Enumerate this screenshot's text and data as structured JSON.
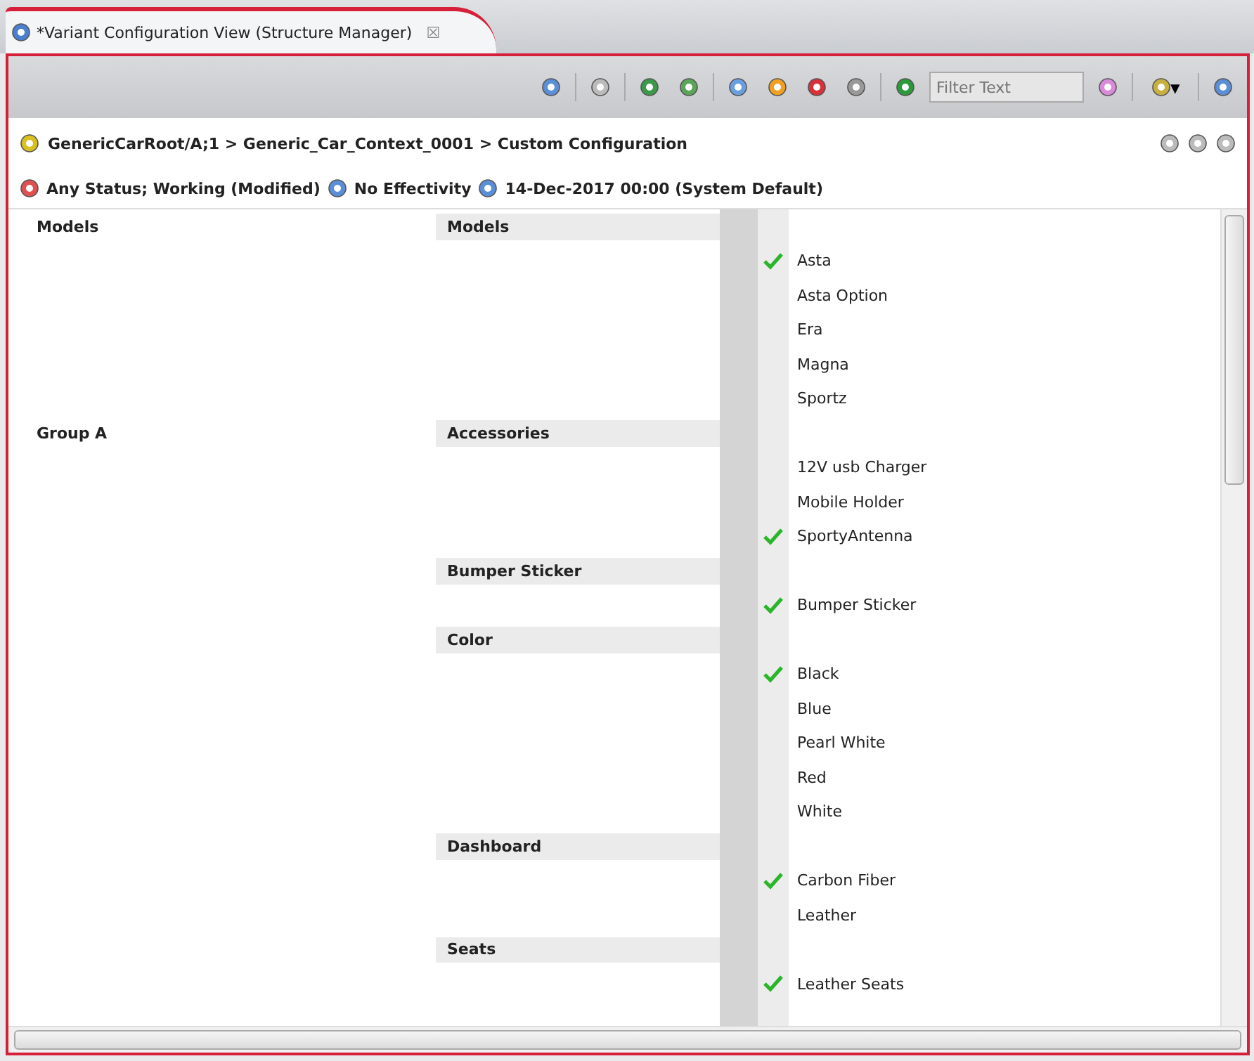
{
  "tab": {
    "title": "*Variant Configuration View (Structure Manager)",
    "close": "☒"
  },
  "toolbar": {
    "filter": {
      "placeholder": "Filter Text"
    },
    "dropdown": "▾"
  },
  "breadcrumb": "GenericCarRoot/A;1 > Generic_Car_Context_0001 > Custom Configuration",
  "status": [
    "Any Status; Working (Modified)",
    "No Effectivity",
    "14-Dec-2017 00:00 (System Default)"
  ],
  "groups": [
    {
      "name": "Models",
      "families": [
        {
          "name": "Models",
          "options": [
            {
              "name": "Asta",
              "checked": true
            },
            {
              "name": "Asta Option",
              "checked": false
            },
            {
              "name": "Era",
              "checked": false
            },
            {
              "name": "Magna",
              "checked": false
            },
            {
              "name": "Sportz",
              "checked": false
            }
          ]
        }
      ]
    },
    {
      "name": "Group A",
      "families": [
        {
          "name": "Accessories",
          "options": [
            {
              "name": "12V usb Charger",
              "checked": false
            },
            {
              "name": "Mobile Holder",
              "checked": false
            },
            {
              "name": "SportyAntenna",
              "checked": true
            }
          ]
        },
        {
          "name": "Bumper Sticker",
          "options": [
            {
              "name": "Bumper Sticker",
              "checked": true
            }
          ]
        },
        {
          "name": "Color",
          "options": [
            {
              "name": "Black",
              "checked": true
            },
            {
              "name": "Blue",
              "checked": false
            },
            {
              "name": "Pearl White",
              "checked": false
            },
            {
              "name": "Red",
              "checked": false
            },
            {
              "name": "White",
              "checked": false
            }
          ]
        },
        {
          "name": "Dashboard",
          "options": [
            {
              "name": "Carbon Fiber",
              "checked": true
            },
            {
              "name": "Leather",
              "checked": false
            }
          ]
        },
        {
          "name": "Seats",
          "options": [
            {
              "name": "Leather Seats",
              "checked": true
            }
          ]
        }
      ]
    }
  ]
}
